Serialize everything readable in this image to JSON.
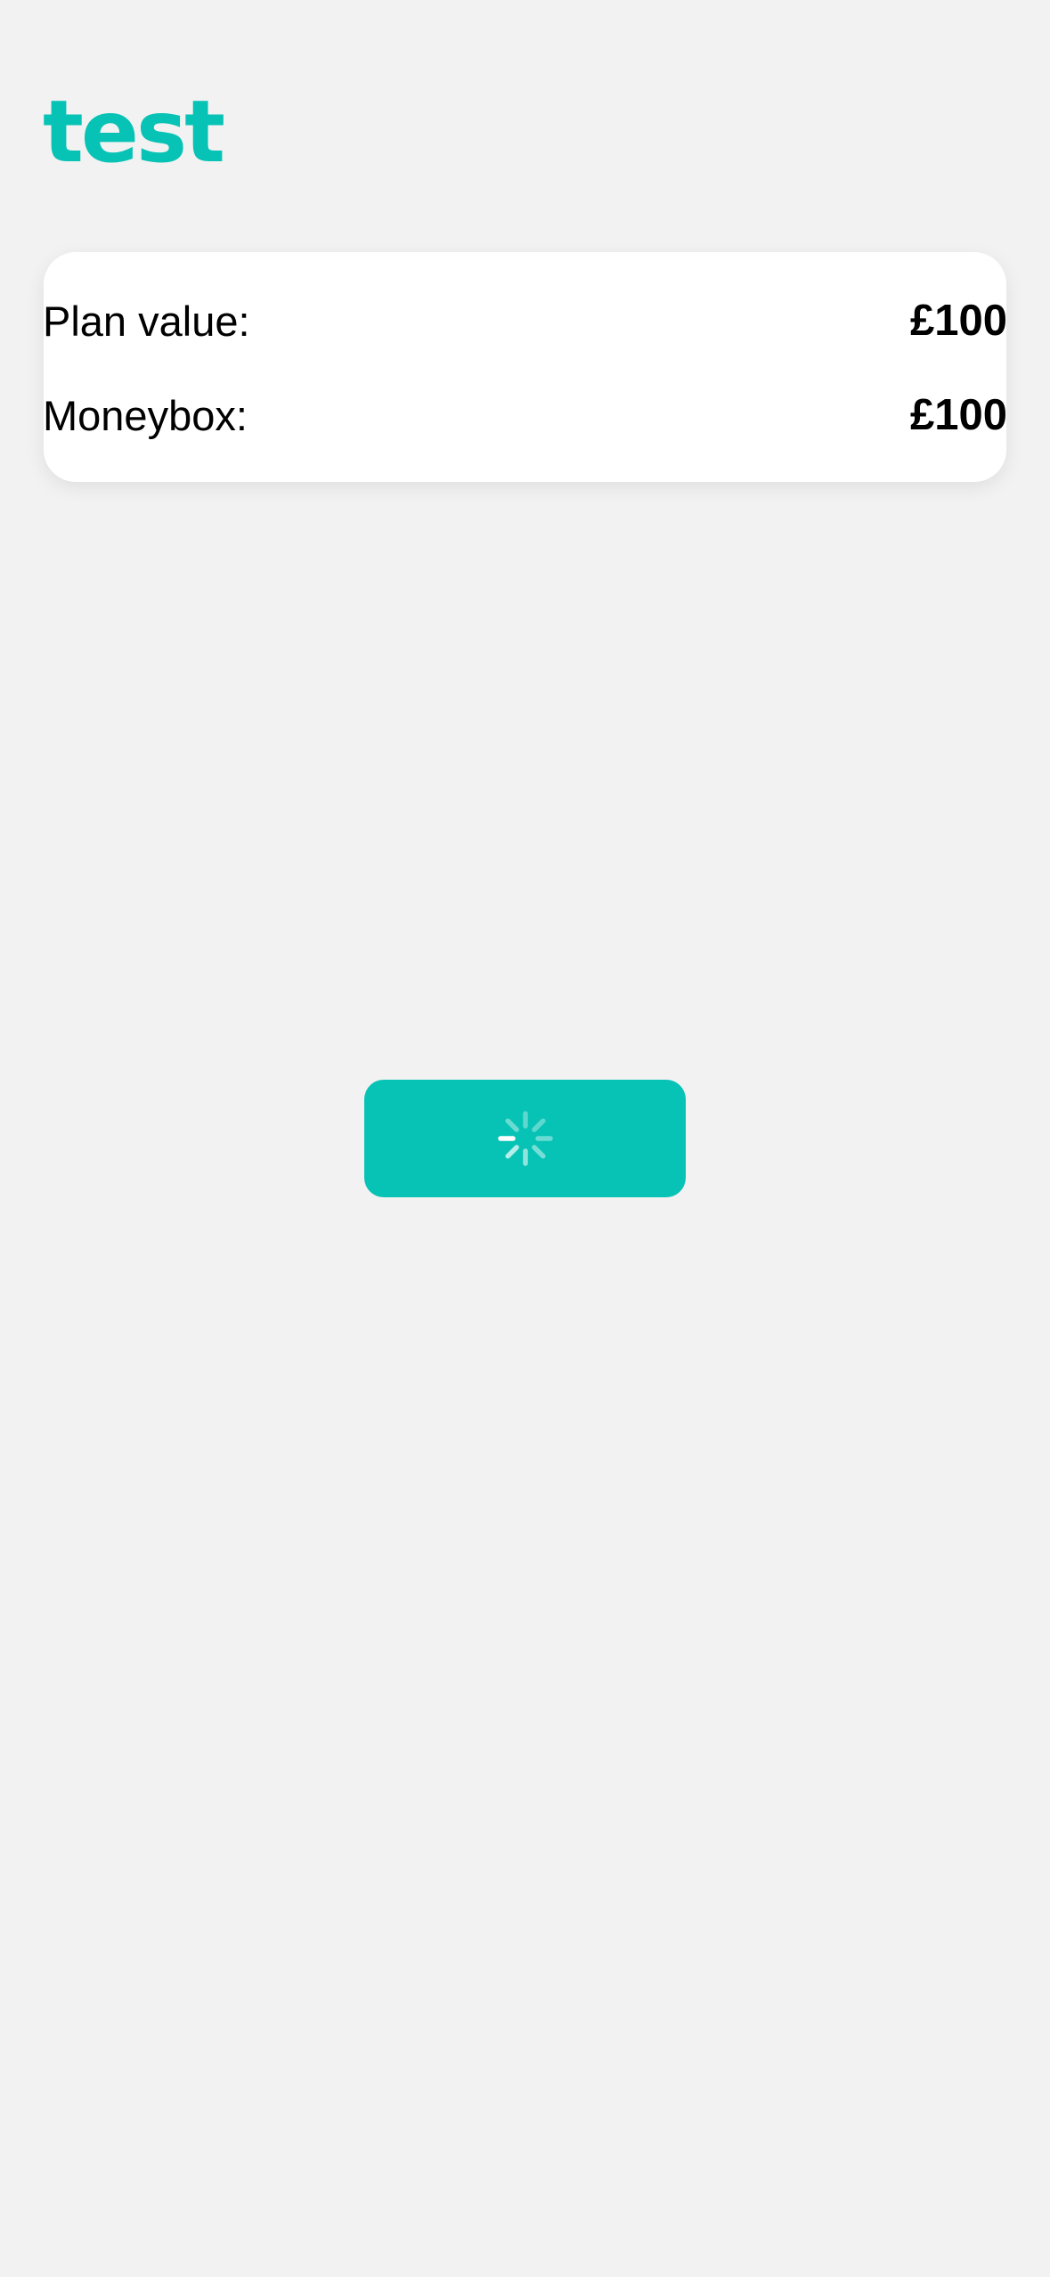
{
  "header": {
    "title": "test"
  },
  "summary": {
    "rows": [
      {
        "label": "Plan value:",
        "value": "£100"
      },
      {
        "label": "Moneybox:",
        "value": "£100"
      }
    ]
  },
  "action_button": {
    "state": "loading",
    "icon": "spinner-icon",
    "color": "#06c3b5"
  },
  "theme": {
    "accent": "#06c3b5",
    "background": "#f2f2f2",
    "card": "#ffffff"
  }
}
